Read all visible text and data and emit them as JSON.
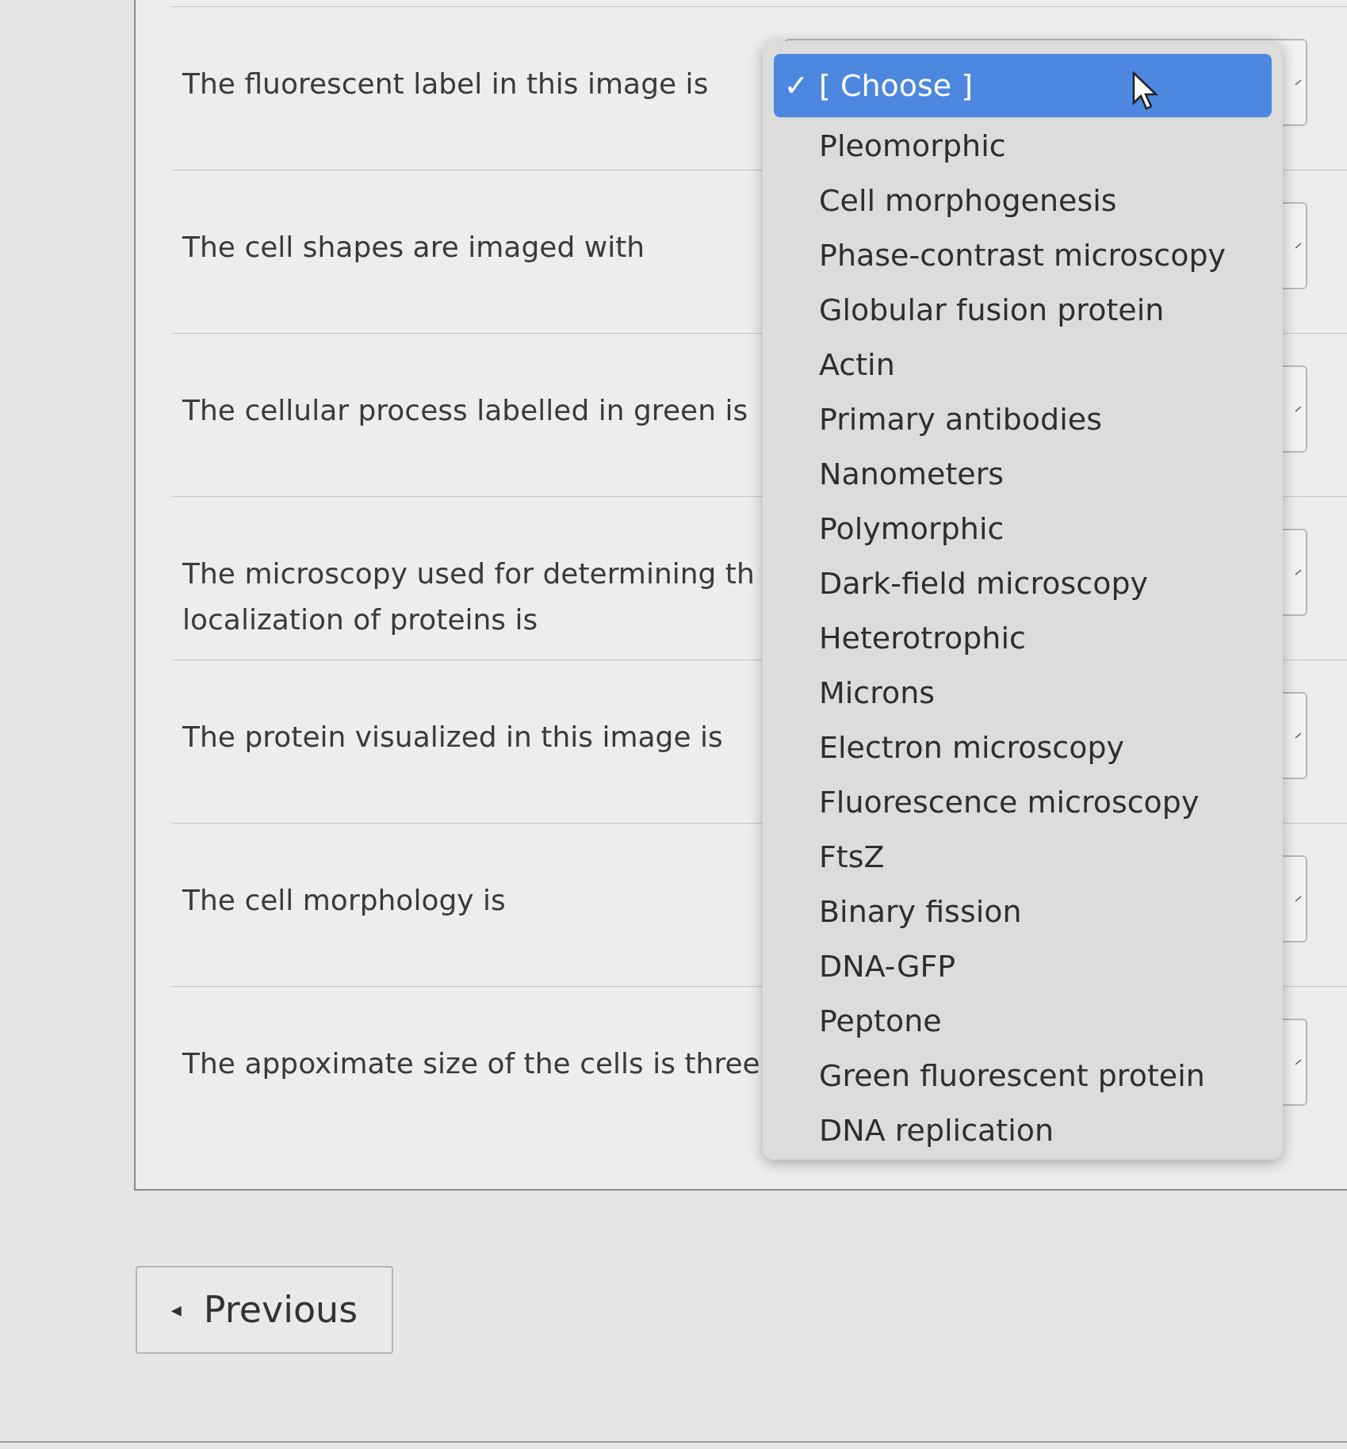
{
  "questions": [
    {
      "text": "The fluorescent label in this image is"
    },
    {
      "text": "The cell shapes are imaged with"
    },
    {
      "text": "The cellular process labelled in green is"
    },
    {
      "text": "The microscopy used for determining th\nlocalization of proteins is"
    },
    {
      "text": "The protein visualized in this image is"
    },
    {
      "text": "The cell morphology is"
    },
    {
      "text": "The appoximate size of the cells is three"
    }
  ],
  "dropdown_menu": {
    "options": [
      {
        "label": "✓",
        "selected": true,
        "text": "[ Choose ]"
      },
      {
        "selected": false,
        "text": "Pleomorphic"
      },
      {
        "selected": false,
        "text": "Cell morphogenesis"
      },
      {
        "selected": false,
        "text": "Phase-contrast microscopy"
      },
      {
        "selected": false,
        "text": "Globular fusion protein"
      },
      {
        "selected": false,
        "text": "Actin"
      },
      {
        "selected": false,
        "text": "Primary antibodies"
      },
      {
        "selected": false,
        "text": "Nanometers"
      },
      {
        "selected": false,
        "text": "Polymorphic"
      },
      {
        "selected": false,
        "text": "Dark-field microscopy"
      },
      {
        "selected": false,
        "text": "Heterotrophic"
      },
      {
        "selected": false,
        "text": "Microns"
      },
      {
        "selected": false,
        "text": "Electron microscopy"
      },
      {
        "selected": false,
        "text": "Fluorescence microscopy"
      },
      {
        "selected": false,
        "text": "FtsZ"
      },
      {
        "selected": false,
        "text": "Binary fission"
      },
      {
        "selected": false,
        "text": "DNA-GFP"
      },
      {
        "selected": false,
        "text": "Peptone"
      },
      {
        "selected": false,
        "text": "Green fluorescent protein"
      },
      {
        "selected": false,
        "text": "DNA replication"
      }
    ]
  },
  "previous_button": {
    "icon": "◂",
    "label": "Previous"
  }
}
